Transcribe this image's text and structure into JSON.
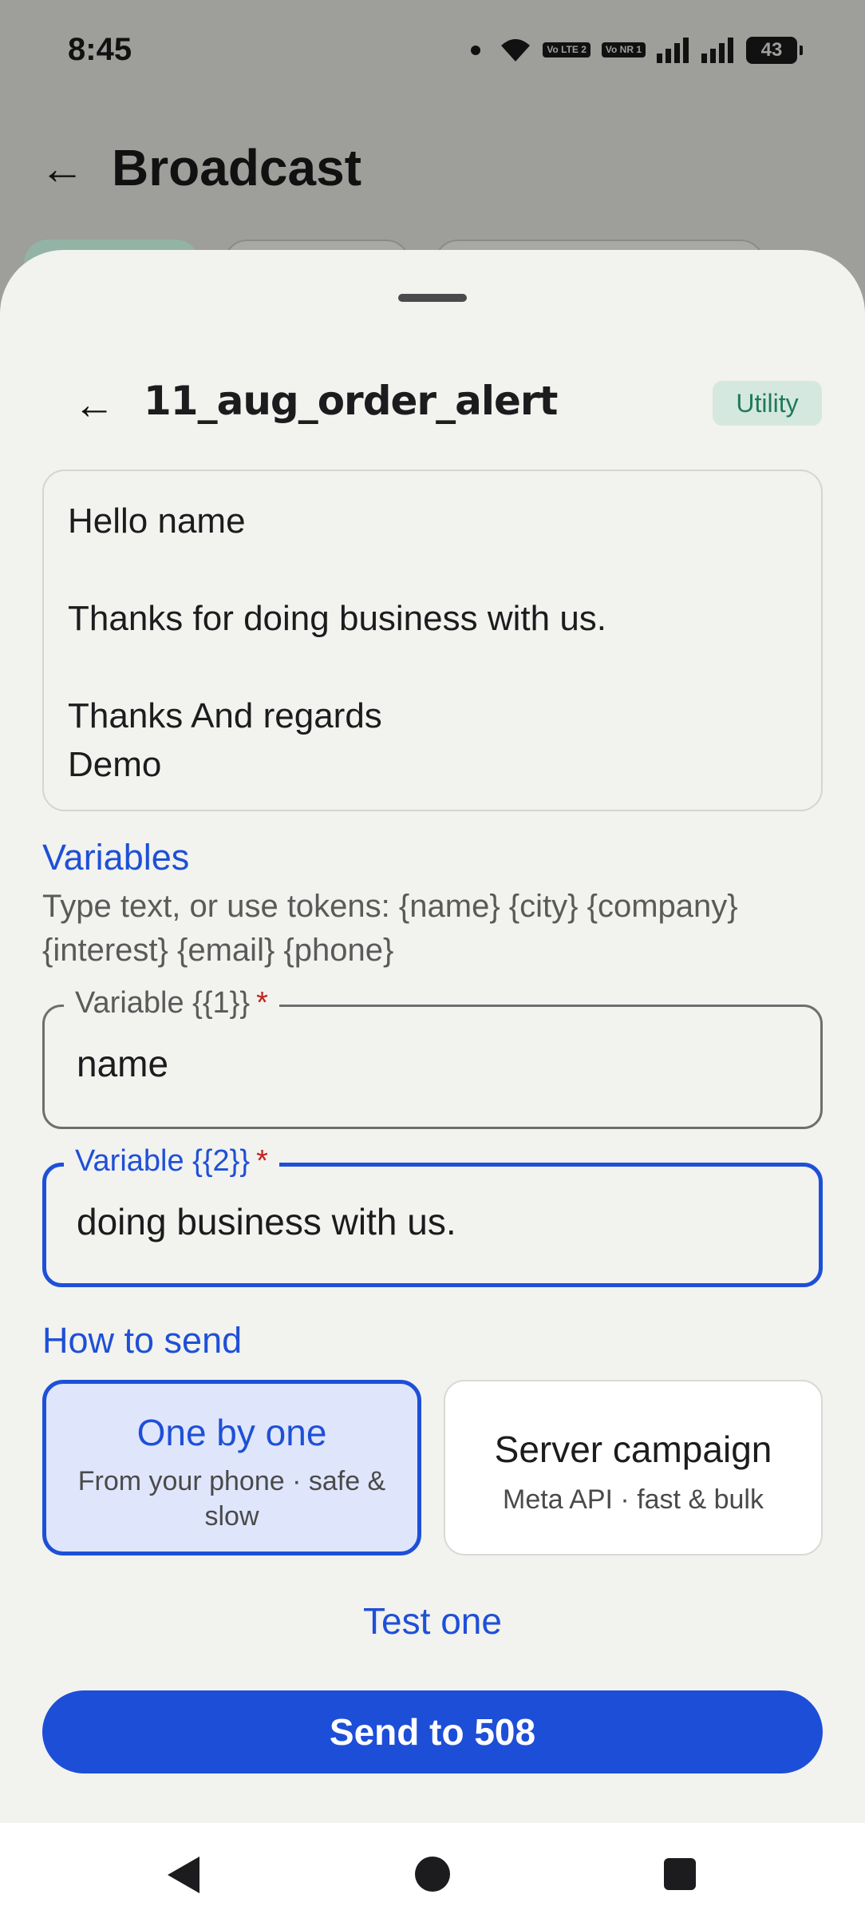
{
  "status_bar": {
    "time": "8:45",
    "sim1_badge": "Vo LTE 2",
    "sim2_badge": "Vo NR 1",
    "battery": "43"
  },
  "background_screen": {
    "title": "Broadcast"
  },
  "sheet": {
    "template_name": "11_aug_order_alert",
    "category": "Utility",
    "preview_lines": [
      "Hello name",
      "",
      "Thanks for doing business with us.",
      "",
      "Thanks And regards",
      "Demo"
    ],
    "variables_section": {
      "title": "Variables",
      "hint": "Type text, or use tokens: {name} {city} {company} {interest} {email} {phone}"
    },
    "variables": [
      {
        "label": "Variable {{1}}",
        "required_mark": "*",
        "value": "name"
      },
      {
        "label": "Variable {{2}}",
        "required_mark": "*",
        "value": "doing business with us."
      }
    ],
    "how_to_send": {
      "title": "How to send",
      "options": [
        {
          "title": "One by one",
          "subtitle": "From your phone · safe & slow",
          "selected": true
        },
        {
          "title": "Server campaign",
          "subtitle": "Meta API · fast & bulk",
          "selected": false
        }
      ]
    },
    "test_label": "Test one",
    "send_label": "Send to 508"
  },
  "colors": {
    "accent": "#1e50d7",
    "primary_button": "#1d4ed8",
    "badge_bg": "#d4e8df",
    "badge_text": "#1f7a5a",
    "sheet_bg": "#f2f2ef",
    "scrim": "#9e9e9b",
    "required": "#c0241c"
  }
}
